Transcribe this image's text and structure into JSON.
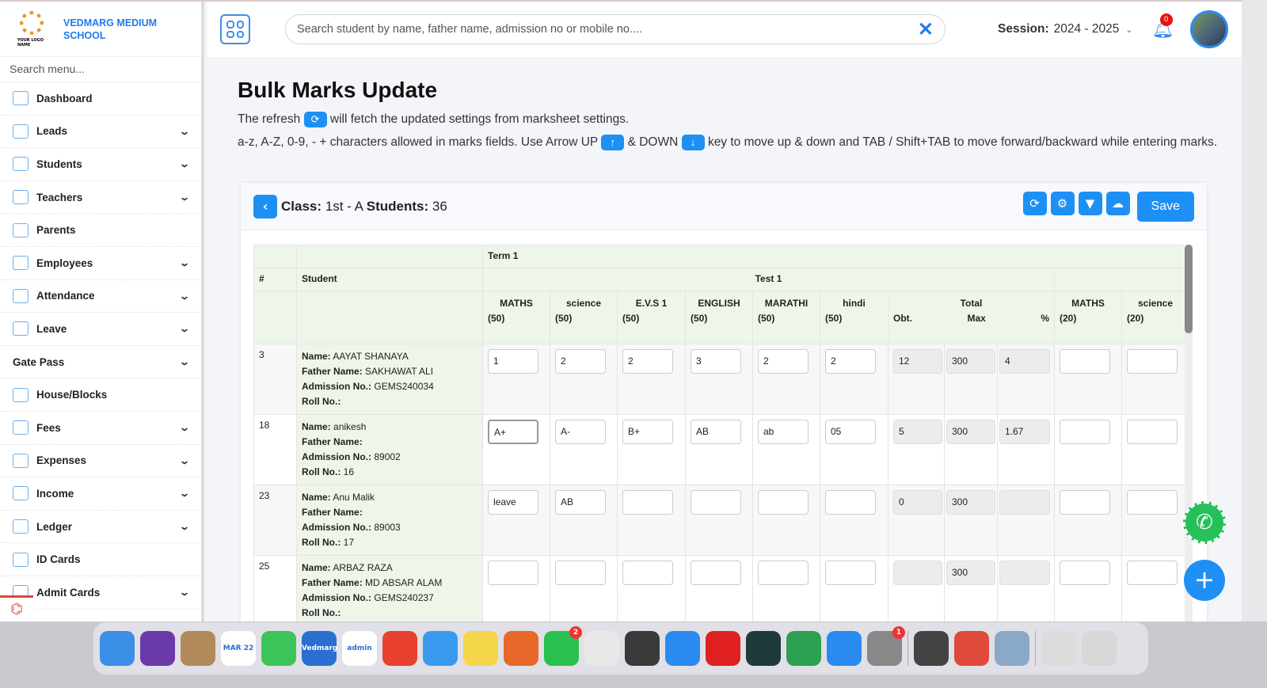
{
  "brand": {
    "name_line1": "VEDMARG MEDIUM",
    "name_line2": "SCHOOL",
    "logo_text": "YOUR LOGO NAME"
  },
  "sidebar": {
    "search_placeholder": "Search menu...",
    "items": [
      {
        "label": "Dashboard",
        "icon": "home-icon",
        "expand": false
      },
      {
        "label": "Leads",
        "icon": "leads-icon",
        "expand": true
      },
      {
        "label": "Students",
        "icon": "students-icon",
        "expand": true
      },
      {
        "label": "Teachers",
        "icon": "teachers-icon",
        "expand": true
      },
      {
        "label": "Parents",
        "icon": "parents-icon",
        "expand": false
      },
      {
        "label": "Employees",
        "icon": "employees-icon",
        "expand": true
      },
      {
        "label": "Attendance",
        "icon": "attendance-icon",
        "expand": true
      },
      {
        "label": "Leave",
        "icon": "leave-icon",
        "expand": true
      },
      {
        "label": "Gate Pass",
        "icon": "",
        "expand": true
      },
      {
        "label": "House/Blocks",
        "icon": "house-icon",
        "expand": false
      },
      {
        "label": "Fees",
        "icon": "fees-icon",
        "expand": true
      },
      {
        "label": "Expenses",
        "icon": "expenses-icon",
        "expand": true
      },
      {
        "label": "Income",
        "icon": "income-icon",
        "expand": true
      },
      {
        "label": "Ledger",
        "icon": "ledger-icon",
        "expand": true
      },
      {
        "label": "ID Cards",
        "icon": "id-card-icon",
        "expand": false
      },
      {
        "label": "Admit Cards",
        "icon": "admit-card-icon",
        "expand": true
      }
    ]
  },
  "header": {
    "search_placeholder": "Search student by name, father name, admission no or mobile no....",
    "session_label": "Session:",
    "session_value": "2024 - 2025",
    "notifications": "0"
  },
  "page": {
    "title": "Bulk Marks Update",
    "note1a": "The refresh",
    "note1b": "will fetch the updated settings from marksheet settings.",
    "note2a": "a-z, A-Z, 0-9, - + characters allowed in marks fields. Use Arrow UP",
    "note2b": "& DOWN",
    "note2c": "key to move up & down and TAB / Shift+TAB to move forward/backward while entering marks."
  },
  "card": {
    "class_label": "Class:",
    "class_value": "1st - A",
    "students_label": "Students:",
    "students_value": "36",
    "save_label": "Save"
  },
  "table": {
    "col_num": "#",
    "col_student": "Student",
    "term": "Term 1",
    "test": "Test 1",
    "subjects": [
      {
        "name": "MATHS",
        "max": "(50)"
      },
      {
        "name": "science",
        "max": "(50)"
      },
      {
        "name": "E.V.S 1",
        "max": "(50)"
      },
      {
        "name": "ENGLISH",
        "max": "(50)"
      },
      {
        "name": "MARATHI",
        "max": "(50)"
      },
      {
        "name": "hindi",
        "max": "(50)"
      }
    ],
    "total": "Total",
    "obt": "Obt.",
    "max": "Max",
    "pct": "%",
    "extra_subjects": [
      {
        "name": "MATHS",
        "max": "(20)"
      },
      {
        "name": "science",
        "max": "(20)"
      }
    ],
    "labels": {
      "name": "Name:",
      "father": "Father Name:",
      "admission": "Admission No.:",
      "roll": "Roll No.:"
    },
    "rows": [
      {
        "num": "3",
        "name": "AAYAT SHANAYA",
        "father": "SAKHAWAT ALI",
        "admission": "GEMS240034",
        "roll": "",
        "marks": [
          "1",
          "2",
          "2",
          "3",
          "2",
          "2"
        ],
        "obt": "12",
        "max": "300",
        "pct": "4",
        "extra": [
          "",
          ""
        ]
      },
      {
        "num": "18",
        "name": "anikesh",
        "father": "",
        "admission": "89002",
        "roll": "16",
        "marks": [
          "A+",
          "A-",
          "B+",
          "AB",
          "ab",
          "05"
        ],
        "obt": "5",
        "max": "300",
        "pct": "1.67",
        "extra": [
          "",
          ""
        ]
      },
      {
        "num": "23",
        "name": "Anu Malik",
        "father": "",
        "admission": "89003",
        "roll": "17",
        "marks": [
          "leave",
          "AB",
          "",
          "",
          "",
          ""
        ],
        "obt": "0",
        "max": "300",
        "pct": "",
        "extra": [
          "",
          ""
        ]
      },
      {
        "num": "25",
        "name": "ARBAZ RAZA",
        "father": "MD ABSAR ALAM",
        "admission": "GEMS240237",
        "roll": "",
        "marks": [
          "",
          "",
          "",
          "",
          "",
          ""
        ],
        "obt": "",
        "max": "300",
        "pct": "",
        "extra": [
          "",
          ""
        ]
      }
    ]
  },
  "dock": [
    {
      "name": "finder",
      "color": "#3a8ee6",
      "label": ""
    },
    {
      "name": "siri",
      "color": "#6a3aa8",
      "label": ""
    },
    {
      "name": "contacts",
      "color": "#b08a5a",
      "label": ""
    },
    {
      "name": "calendar",
      "color": "#ffffff",
      "label": "MAR 22"
    },
    {
      "name": "facetime",
      "color": "#3cc45a",
      "label": ""
    },
    {
      "name": "vedmarg",
      "color": "#2a6fd0",
      "label": "Vedmarg"
    },
    {
      "name": "vedmarg-admin",
      "color": "#ffffff",
      "label": "admin"
    },
    {
      "name": "anydesk",
      "color": "#e8402f",
      "label": ""
    },
    {
      "name": "mail",
      "color": "#3a9af0",
      "label": ""
    },
    {
      "name": "notes",
      "color": "#f5d64a",
      "label": ""
    },
    {
      "name": "firefox",
      "color": "#e8682a",
      "label": ""
    },
    {
      "name": "whatsapp",
      "color": "#2ac04f",
      "label": "",
      "badge": "2"
    },
    {
      "name": "chrome",
      "color": "#e8e8e8",
      "label": ""
    },
    {
      "name": "sublime",
      "color": "#3a3a3a",
      "label": ""
    },
    {
      "name": "safari",
      "color": "#2a8af0",
      "label": ""
    },
    {
      "name": "opera",
      "color": "#e02020",
      "label": ""
    },
    {
      "name": "filmora",
      "color": "#1f3a3a",
      "label": ""
    },
    {
      "name": "pen",
      "color": "#2aa050",
      "label": ""
    },
    {
      "name": "app-store",
      "color": "#2a8af0",
      "label": ""
    },
    {
      "name": "system-settings",
      "color": "#888888",
      "label": "",
      "badge": "1"
    },
    {
      "name": "quicktime",
      "color": "#444",
      "label": ""
    },
    {
      "name": "remote-desktop",
      "color": "#e04a3a",
      "label": ""
    },
    {
      "name": "preview",
      "color": "#8aa8c8",
      "label": ""
    },
    {
      "name": "scanner",
      "color": "#dcdcdc",
      "label": ""
    },
    {
      "name": "trash",
      "color": "#d8d8d8",
      "label": ""
    }
  ]
}
